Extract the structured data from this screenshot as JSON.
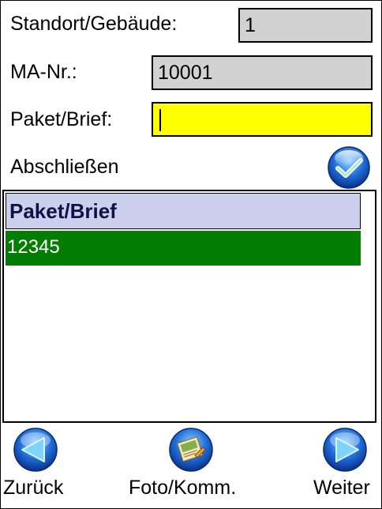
{
  "form": {
    "location_label": "Standort/Gebäude:",
    "location_value": "1",
    "employee_label": "MA-Nr.:",
    "employee_value": "10001",
    "parcel_label": "Paket/Brief:",
    "parcel_value": "",
    "finish_label": "Abschließen"
  },
  "list": {
    "header": "Paket/Brief",
    "rows": [
      {
        "value": "12345"
      }
    ],
    "selected_row_color": "#047d04",
    "header_color": "#ccd0ec"
  },
  "nav": {
    "back_label": "Zurück",
    "back_icon": "arrow-left-icon",
    "photo_label": "Foto/Komm.",
    "photo_icon": "photo-comment-icon",
    "next_label": "Weiter",
    "next_icon": "arrow-right-icon"
  },
  "colors": {
    "active_field": "#ffff00",
    "readonly_field": "#d2d2d2"
  }
}
